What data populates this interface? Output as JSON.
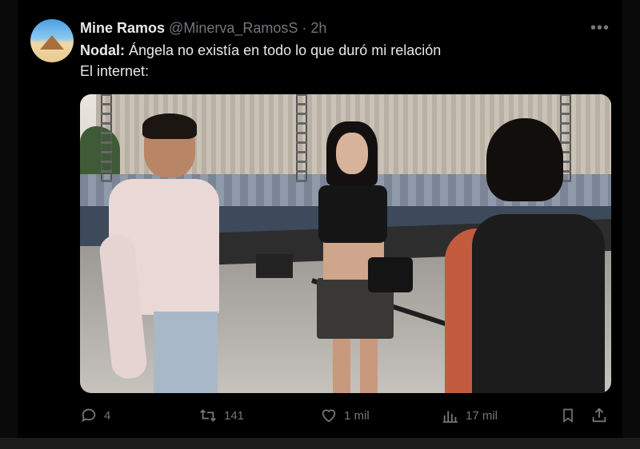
{
  "tweet": {
    "display_name": "Mine Ramos",
    "handle": "@Minerva_RamosS",
    "separator": "·",
    "time": "2h",
    "text_lead": "Nodal:",
    "text_line1_rest": " Ángela no existía en todo lo que duró mi relación",
    "text_line2": "El internet:"
  },
  "actions": {
    "replies": "4",
    "retweets": "141",
    "likes": "1 mil",
    "views": "17 mil"
  },
  "colors": {
    "background": "#000000",
    "text": "#e7e9ea",
    "muted": "#71767b"
  },
  "icons": [
    "avatar",
    "more-icon",
    "reply-icon",
    "retweet-icon",
    "like-icon",
    "views-icon",
    "bookmark-icon",
    "share-icon"
  ]
}
